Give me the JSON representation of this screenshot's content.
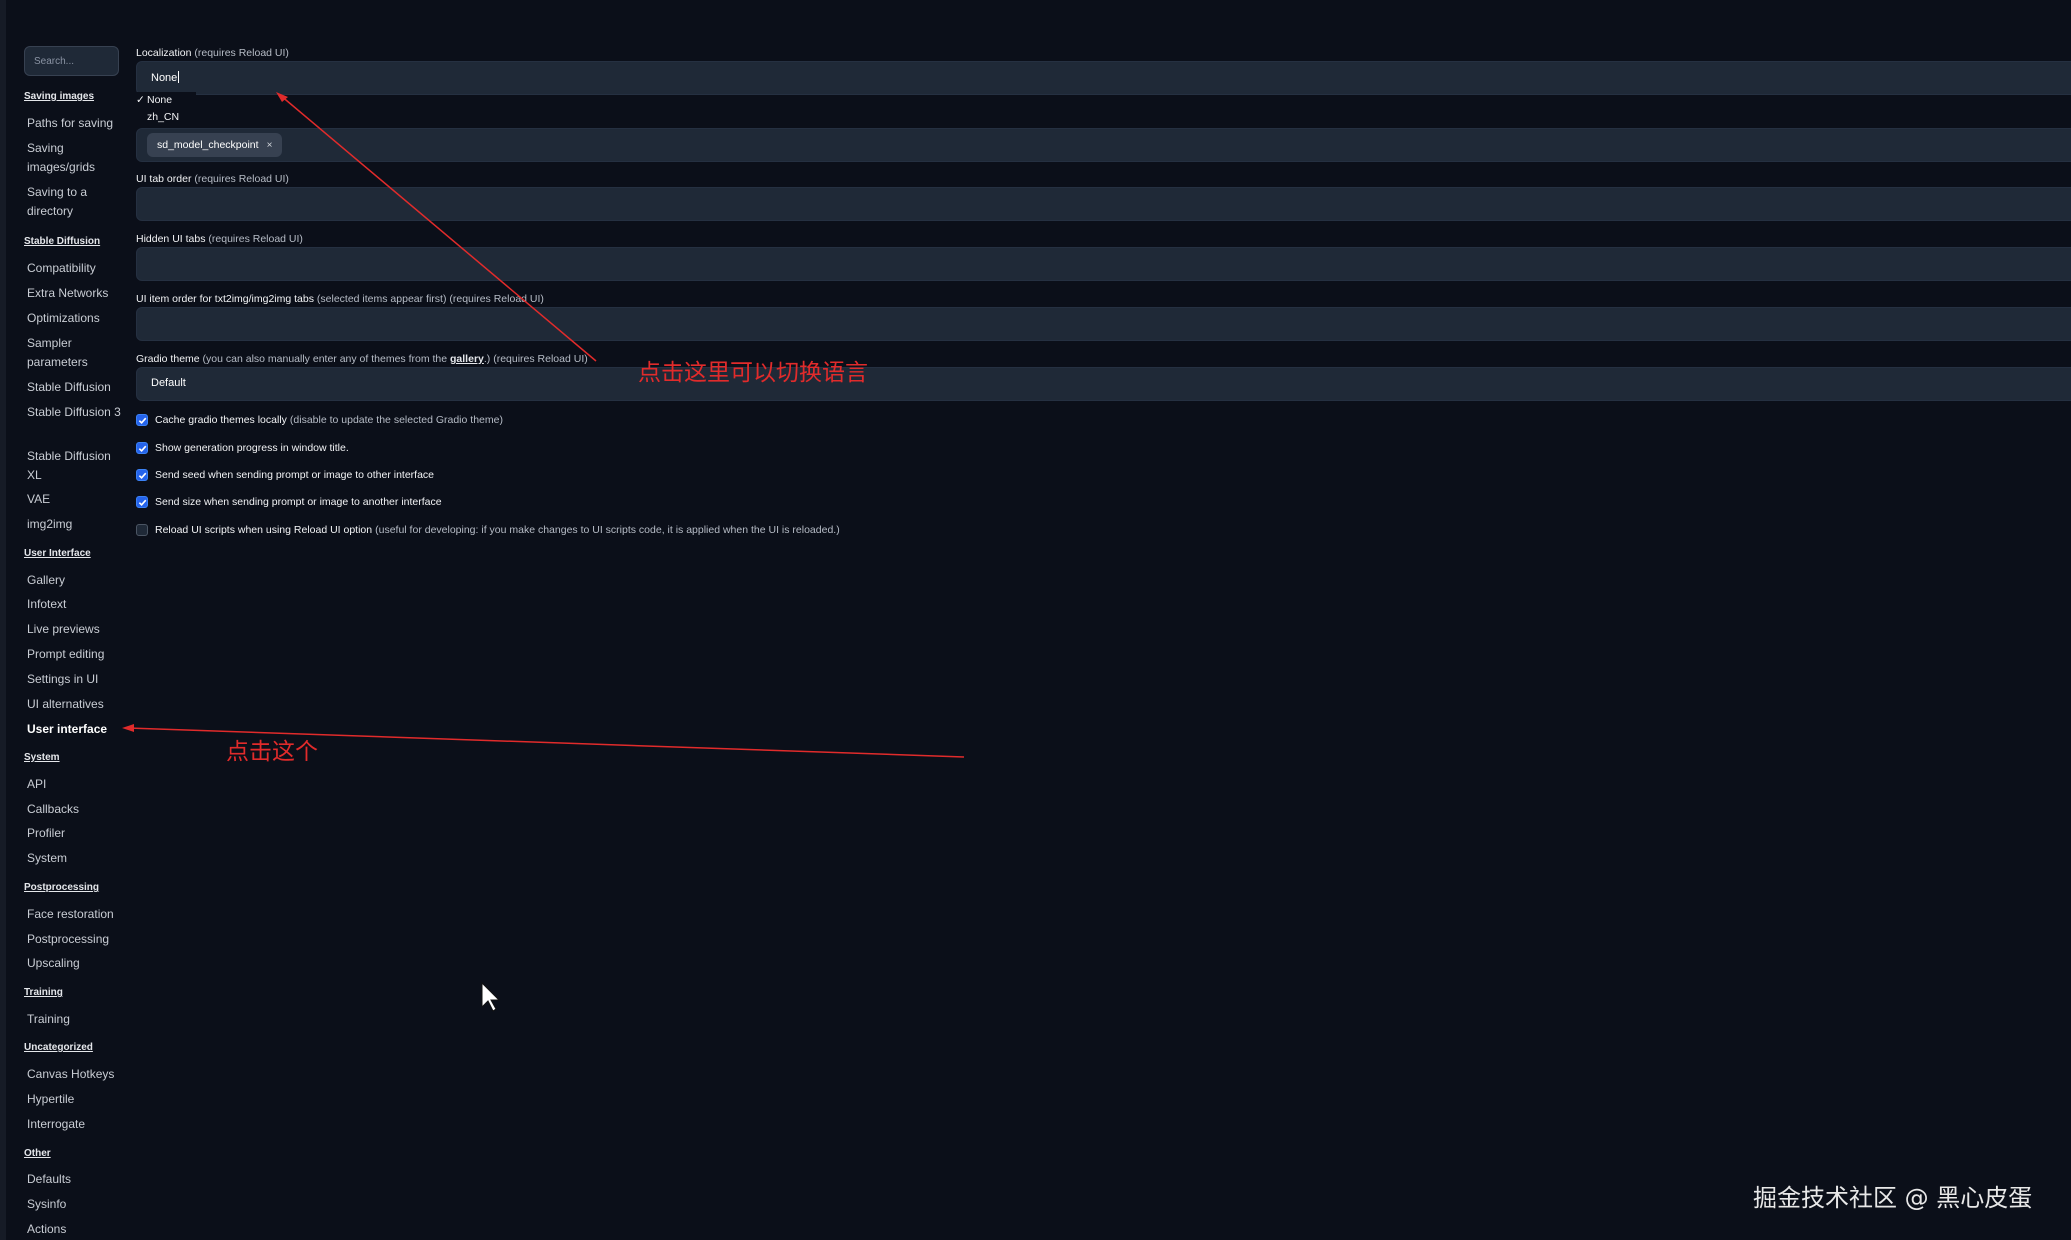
{
  "search": {
    "placeholder": "Search..."
  },
  "sidebar": {
    "sections": [
      {
        "title": "Saving images",
        "items": [
          "Paths for saving",
          "Saving images/grids",
          "Saving to a directory"
        ]
      },
      {
        "title": "Stable Diffusion",
        "items": [
          "Compatibility",
          "Extra Networks",
          "Optimizations",
          "Sampler parameters",
          "Stable Diffusion",
          "Stable Diffusion 3",
          "Stable Diffusion XL",
          "VAE",
          "img2img"
        ]
      },
      {
        "title": "User Interface",
        "items": [
          "Gallery",
          "Infotext",
          "Live previews",
          "Prompt editing",
          "Settings in UI",
          "UI alternatives",
          "User interface"
        ]
      },
      {
        "title": "System",
        "items": [
          "API",
          "Callbacks",
          "Profiler",
          "System"
        ]
      },
      {
        "title": "Postprocessing",
        "items": [
          "Face restoration",
          "Postprocessing",
          "Upscaling"
        ]
      },
      {
        "title": "Training",
        "items": [
          "Training"
        ]
      },
      {
        "title": "Uncategorized",
        "items": [
          "Canvas Hotkeys",
          "Hypertile",
          "Interrogate"
        ]
      },
      {
        "title": "Other",
        "items": [
          "Defaults",
          "Sysinfo",
          "Actions"
        ]
      }
    ],
    "active_item": "User interface"
  },
  "settings": {
    "localization": {
      "label": "Localization",
      "hint": "(requires Reload UI)",
      "value": "None",
      "options": [
        {
          "check": "✓",
          "label": "None"
        },
        {
          "check": "",
          "label": "zh_CN"
        }
      ]
    },
    "quicksettings": {
      "chip": "sd_model_checkpoint",
      "chip_remove": "×"
    },
    "ui_tab_order": {
      "label": "UI tab order",
      "hint": "(requires Reload UI)"
    },
    "hidden_ui_tabs": {
      "label": "Hidden UI tabs",
      "hint": "(requires Reload UI)"
    },
    "ui_item_order": {
      "label": "UI item order for txt2img/img2img tabs",
      "hint": "(selected items appear first) (requires Reload UI)"
    },
    "gradio_theme": {
      "label": "Gradio theme",
      "hint_pre": "(you can also manually enter any of themes from the ",
      "link": "gallery",
      "hint_post": ".) (requires Reload UI)",
      "value": "Default"
    },
    "checkboxes": [
      {
        "label": "Cache gradio themes locally",
        "hint": "(disable to update the selected Gradio theme)",
        "checked": true
      },
      {
        "label": "Show generation progress in window title.",
        "hint": "",
        "checked": true
      },
      {
        "label": "Send seed when sending prompt or image to other interface",
        "hint": "",
        "checked": true
      },
      {
        "label": "Send size when sending prompt or image to another interface",
        "hint": "",
        "checked": true
      },
      {
        "label": "Reload UI scripts when using Reload UI option",
        "hint": "(useful for developing: if you make changes to UI scripts code, it is applied when the UI is reloaded.)",
        "checked": false
      }
    ]
  },
  "annotations": {
    "switch_language": "点击这里可以切换语言",
    "click_this": "点击这个",
    "color": "#e12b2b"
  },
  "watermark": "掘金技术社区 @ 黑心皮蛋"
}
